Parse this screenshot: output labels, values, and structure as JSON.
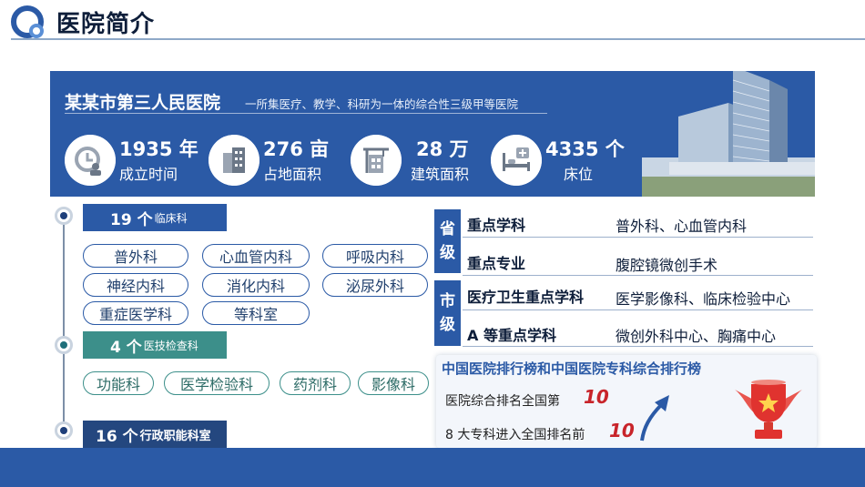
{
  "page": {
    "title": "医院简介"
  },
  "banner": {
    "hospital_name": "某某市第三人民医院",
    "hospital_desc": "一所集医疗、教学、科研为一体的综合性三级甲等医院",
    "stats": [
      {
        "value": "1935 年",
        "label": "成立时间",
        "icon": "clock-person-icon"
      },
      {
        "value": "276 亩",
        "label": "占地面积",
        "icon": "buildings-icon"
      },
      {
        "value": "28 万",
        "label": "建筑面积",
        "icon": "building-crane-icon"
      },
      {
        "value": "4335 个",
        "label": "床位",
        "icon": "hospital-bed-icon"
      }
    ]
  },
  "departments": {
    "clinical": {
      "num": "19 个",
      "label": "临床科",
      "items": [
        "普外科",
        "心血管内科",
        "呼吸内科",
        "神经内科",
        "消化内科",
        "泌尿外科",
        "重症医学科",
        "等科室"
      ]
    },
    "medtech": {
      "num": "4 个",
      "label": "医技检查科",
      "items": [
        "功能科",
        "医学检验科",
        "药剂科",
        "影像科"
      ]
    },
    "admin": {
      "num": "16 个",
      "label": "行政职能科室"
    }
  },
  "key_disciplines": {
    "provincial_tag": [
      "省",
      "级"
    ],
    "city_tag": [
      "市",
      "级"
    ],
    "rows": [
      {
        "title": "重点学科",
        "value": "普外科、心血管内科"
      },
      {
        "title": "重点专业",
        "value": "腹腔镜微创手术"
      },
      {
        "title": "医疗卫生重点学科",
        "value": "医学影像科、临床检验中心"
      },
      {
        "title": "A 等重点学科",
        "value": "微创外科中心、胸痛中心"
      }
    ]
  },
  "ranking": {
    "title": "中国医院排行榜和中国医院专科综合排行榜",
    "line1": "医院综合排名全国第",
    "num1": "10",
    "line2": "8 大专科进入全国排名前",
    "num2": "10"
  },
  "colors": {
    "primary": "#2b5aa6",
    "teal": "#3c8f8a",
    "accent_red": "#c8242a"
  }
}
